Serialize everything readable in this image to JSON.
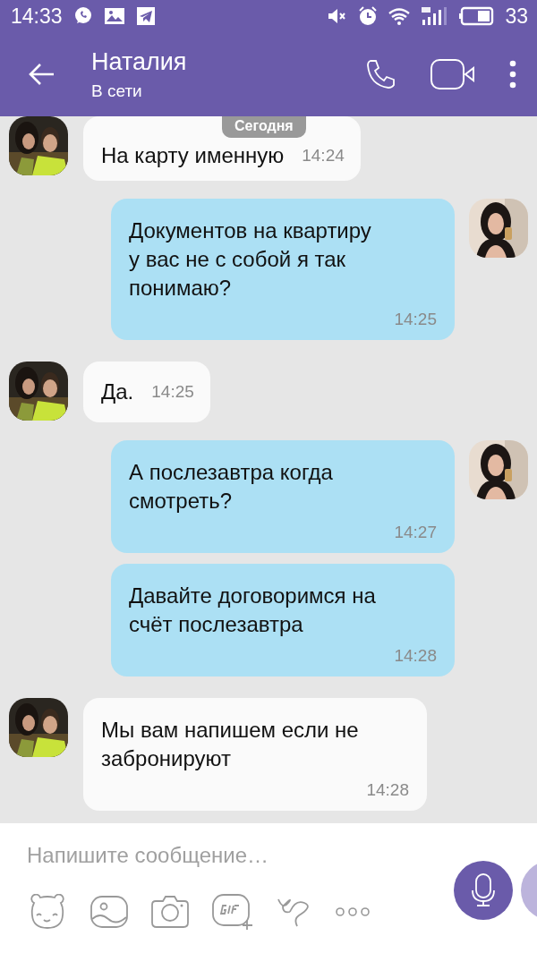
{
  "status_bar": {
    "time": "14:33",
    "battery": "33"
  },
  "header": {
    "title": "Наталия",
    "subtitle": "В сети"
  },
  "date_chip": "Сегодня",
  "messages": [
    {
      "kind": "incoming",
      "show_avatar": true,
      "text": "На карту именную",
      "time": "14:24"
    },
    {
      "kind": "outgoing",
      "show_avatar": true,
      "text": "Документов на квартиру\nу вас не с собой я так\nпонимаю?",
      "time": "14:25"
    },
    {
      "kind": "incoming",
      "show_avatar": true,
      "text": "Да.",
      "time": "14:25"
    },
    {
      "kind": "outgoing",
      "show_avatar": true,
      "text": "А послезавтра когда\nсмотреть?",
      "time": "14:27"
    },
    {
      "kind": "outgoing",
      "show_avatar": false,
      "text": "Давайте договоримся на\nсчёт послезавтра",
      "time": "14:28"
    },
    {
      "kind": "incoming",
      "show_avatar": true,
      "text": "Мы вам напишем если не\nзабронируют",
      "time": "14:28"
    }
  ],
  "composer": {
    "placeholder": "Напишите сообщение…"
  }
}
